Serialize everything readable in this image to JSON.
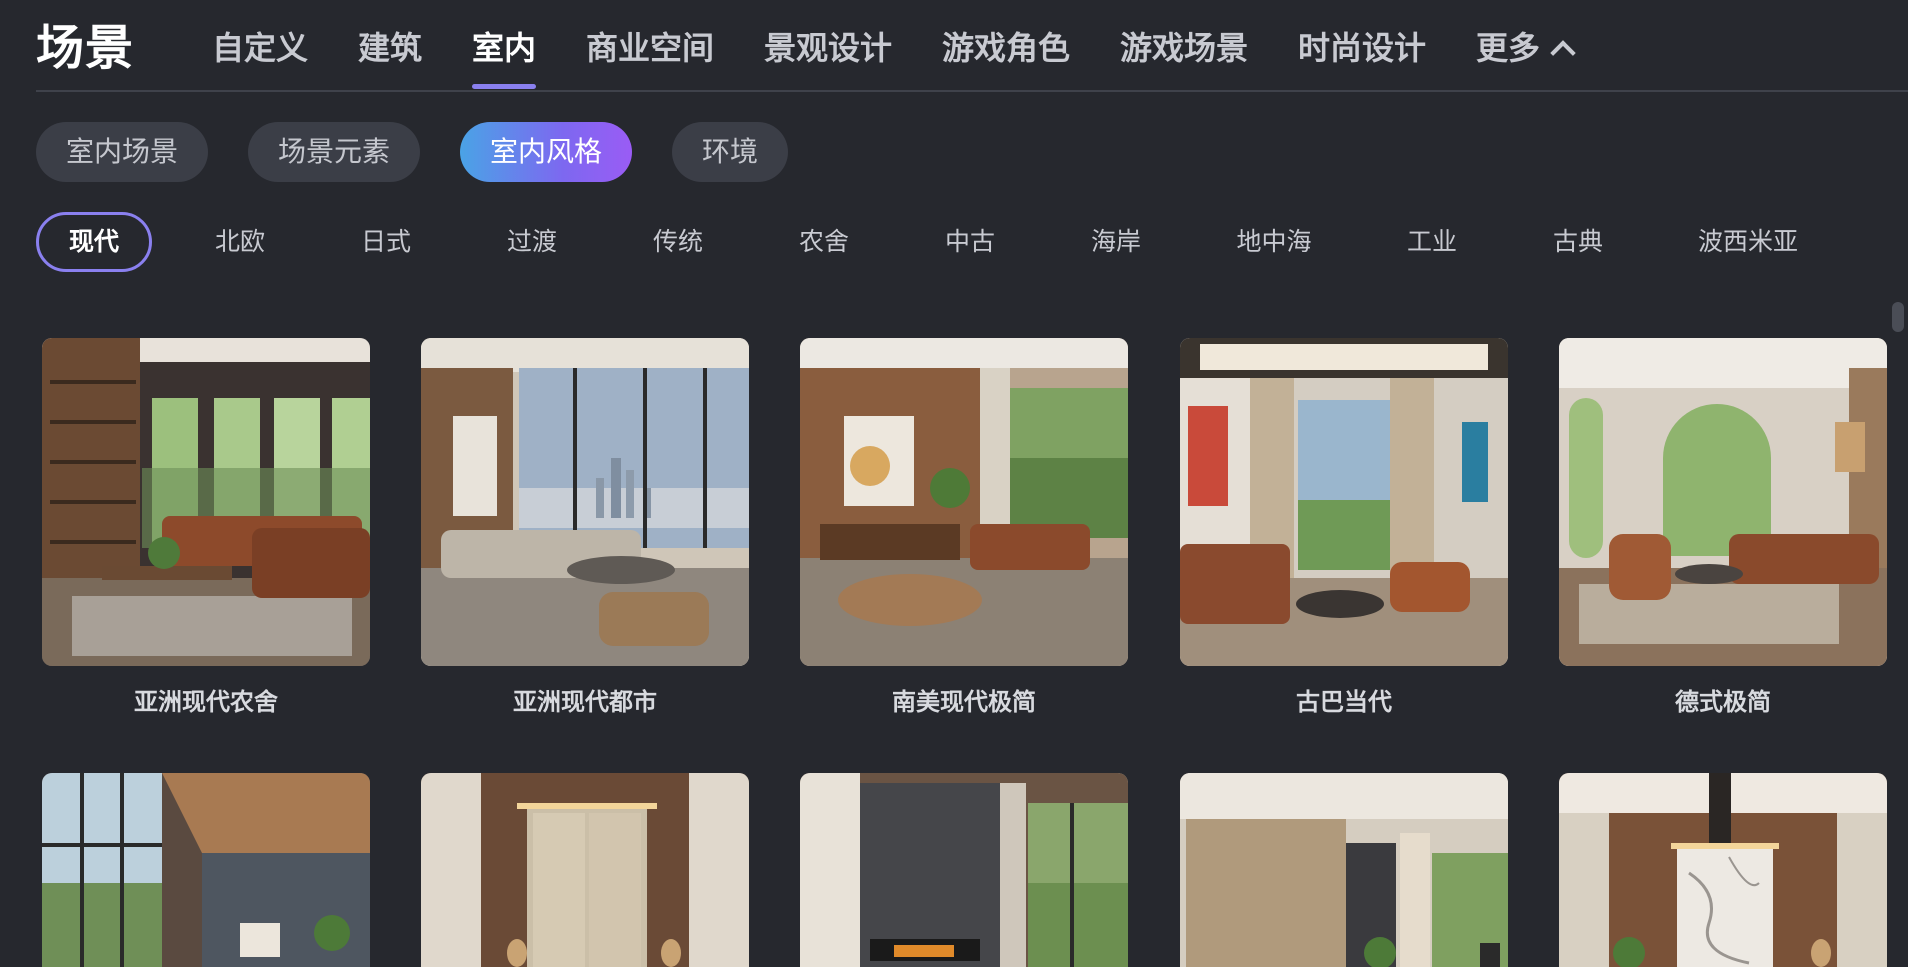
{
  "header": {
    "title": "场景",
    "tabs": [
      {
        "label": "自定义",
        "active": false
      },
      {
        "label": "建筑",
        "active": false
      },
      {
        "label": "室内",
        "active": true
      },
      {
        "label": "商业空间",
        "active": false
      },
      {
        "label": "景观设计",
        "active": false
      },
      {
        "label": "游戏角色",
        "active": false
      },
      {
        "label": "游戏场景",
        "active": false
      },
      {
        "label": "时尚设计",
        "active": false
      },
      {
        "label": "更多",
        "active": false,
        "icon": "chevron-up-icon"
      }
    ]
  },
  "categories": [
    {
      "label": "室内场景",
      "active": false
    },
    {
      "label": "场景元素",
      "active": false
    },
    {
      "label": "室内风格",
      "active": true
    },
    {
      "label": "环境",
      "active": false
    }
  ],
  "styles": [
    {
      "label": "现代",
      "active": true
    },
    {
      "label": "北欧",
      "active": false
    },
    {
      "label": "日式",
      "active": false
    },
    {
      "label": "过渡",
      "active": false
    },
    {
      "label": "传统",
      "active": false
    },
    {
      "label": "农舍",
      "active": false
    },
    {
      "label": "中古",
      "active": false
    },
    {
      "label": "海岸",
      "active": false
    },
    {
      "label": "地中海",
      "active": false
    },
    {
      "label": "工业",
      "active": false
    },
    {
      "label": "古典",
      "active": false
    },
    {
      "label": "波西米亚",
      "active": false
    }
  ],
  "cards_row1": [
    {
      "title": "亚洲现代农舍",
      "image": "modern-living-room-with-shelves"
    },
    {
      "title": "亚洲现代都市",
      "image": "city-view-living-room"
    },
    {
      "title": "南美现代极简",
      "image": "wood-wall-living-room"
    },
    {
      "title": "古巴当代",
      "image": "curtained-living-room"
    },
    {
      "title": "德式极简",
      "image": "arched-window-living-room"
    }
  ],
  "cards_row2": [
    {
      "title": "",
      "image": "wood-ceiling-room"
    },
    {
      "title": "",
      "image": "panel-wall-bedroom"
    },
    {
      "title": "",
      "image": "fireplace-room"
    },
    {
      "title": "",
      "image": "beige-wall-room"
    },
    {
      "title": "",
      "image": "marble-wall-room"
    }
  ],
  "colors": {
    "background": "#26282e",
    "accent": "#8a80ef",
    "pill_gradient_start": "#4aa3e6",
    "pill_gradient_end": "#9a5cf5"
  }
}
